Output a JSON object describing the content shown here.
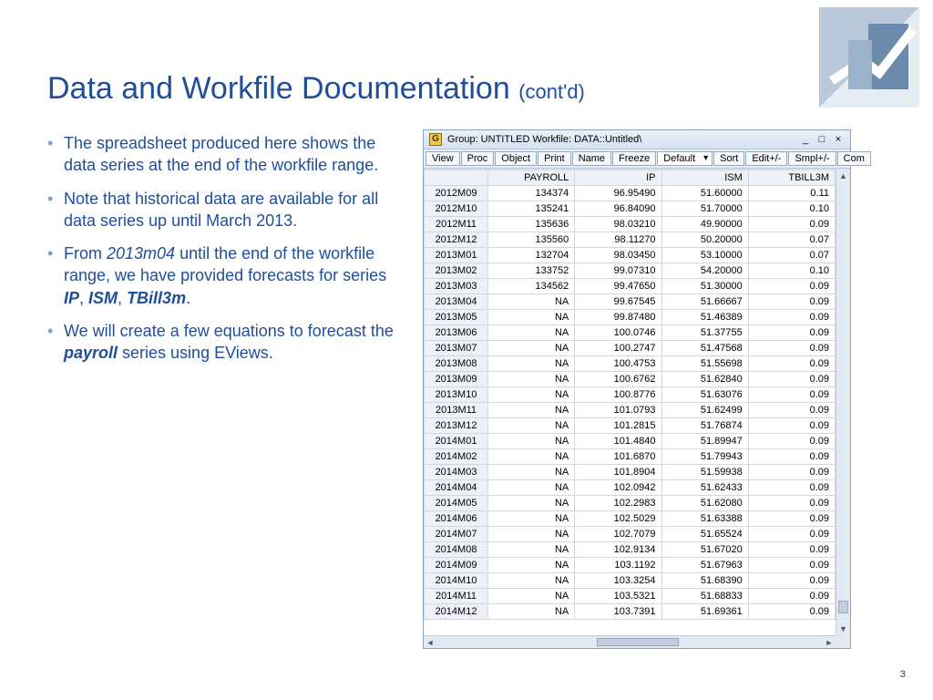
{
  "title_main": "Data and Workfile Documentation ",
  "title_contd": "(cont'd)",
  "bullets": [
    {
      "html": "The spreadsheet produced here shows the data series at the end of the workfile range."
    },
    {
      "html": " Note that historical data are available for all data series up until March 2013."
    },
    {
      "html": "From <em>2013m04</em> until the end of the workfile range, we have provided forecasts for series <strong>IP</strong>, <strong>ISM</strong>, <strong>TBill3m</strong>."
    },
    {
      "html": "We will create a few equations to forecast the <strong>payroll</strong> series using EViews."
    }
  ],
  "win": {
    "icon_letter": "G",
    "title": "Group: UNTITLED   Workfile: DATA::Untitled\\",
    "ctl_min": "_",
    "ctl_max": "□",
    "ctl_close": "×"
  },
  "toolbar": {
    "view": "View",
    "proc": "Proc",
    "object": "Object",
    "print": "Print",
    "name": "Name",
    "freeze": "Freeze",
    "default": "Default",
    "sort": "Sort",
    "editpm": "Edit+/-",
    "smplpm": "Smpl+/-",
    "com": "Com"
  },
  "columns": [
    "PAYROLL",
    "IP",
    "ISM",
    "TBILL3M"
  ],
  "rows": [
    {
      "obs": "2012M09",
      "c": [
        "134374",
        "96.95490",
        "51.60000",
        "0.11"
      ]
    },
    {
      "obs": "2012M10",
      "c": [
        "135241",
        "96.84090",
        "51.70000",
        "0.10"
      ]
    },
    {
      "obs": "2012M11",
      "c": [
        "135636",
        "98.03210",
        "49.90000",
        "0.09"
      ]
    },
    {
      "obs": "2012M12",
      "c": [
        "135560",
        "98.11270",
        "50.20000",
        "0.07"
      ]
    },
    {
      "obs": "2013M01",
      "c": [
        "132704",
        "98.03450",
        "53.10000",
        "0.07"
      ]
    },
    {
      "obs": "2013M02",
      "c": [
        "133752",
        "99.07310",
        "54.20000",
        "0.10"
      ]
    },
    {
      "obs": "2013M03",
      "c": [
        "134562",
        "99.47650",
        "51.30000",
        "0.09"
      ]
    },
    {
      "obs": "2013M04",
      "c": [
        "NA",
        "99.67545",
        "51.66667",
        "0.09"
      ]
    },
    {
      "obs": "2013M05",
      "c": [
        "NA",
        "99.87480",
        "51.46389",
        "0.09"
      ]
    },
    {
      "obs": "2013M06",
      "c": [
        "NA",
        "100.0746",
        "51.37755",
        "0.09"
      ]
    },
    {
      "obs": "2013M07",
      "c": [
        "NA",
        "100.2747",
        "51.47568",
        "0.09"
      ]
    },
    {
      "obs": "2013M08",
      "c": [
        "NA",
        "100.4753",
        "51.55698",
        "0.09"
      ]
    },
    {
      "obs": "2013M09",
      "c": [
        "NA",
        "100.6762",
        "51.62840",
        "0.09"
      ]
    },
    {
      "obs": "2013M10",
      "c": [
        "NA",
        "100.8776",
        "51.63076",
        "0.09"
      ]
    },
    {
      "obs": "2013M11",
      "c": [
        "NA",
        "101.0793",
        "51.62499",
        "0.09"
      ]
    },
    {
      "obs": "2013M12",
      "c": [
        "NA",
        "101.2815",
        "51.76874",
        "0.09"
      ]
    },
    {
      "obs": "2014M01",
      "c": [
        "NA",
        "101.4840",
        "51.89947",
        "0.09"
      ]
    },
    {
      "obs": "2014M02",
      "c": [
        "NA",
        "101.6870",
        "51.79943",
        "0.09"
      ]
    },
    {
      "obs": "2014M03",
      "c": [
        "NA",
        "101.8904",
        "51.59938",
        "0.09"
      ]
    },
    {
      "obs": "2014M04",
      "c": [
        "NA",
        "102.0942",
        "51.62433",
        "0.09"
      ]
    },
    {
      "obs": "2014M05",
      "c": [
        "NA",
        "102.2983",
        "51.62080",
        "0.09"
      ]
    },
    {
      "obs": "2014M06",
      "c": [
        "NA",
        "102.5029",
        "51.63388",
        "0.09"
      ]
    },
    {
      "obs": "2014M07",
      "c": [
        "NA",
        "102.7079",
        "51.65524",
        "0.09"
      ]
    },
    {
      "obs": "2014M08",
      "c": [
        "NA",
        "102.9134",
        "51.67020",
        "0.09"
      ]
    },
    {
      "obs": "2014M09",
      "c": [
        "NA",
        "103.1192",
        "51.67963",
        "0.09"
      ]
    },
    {
      "obs": "2014M10",
      "c": [
        "NA",
        "103.3254",
        "51.68390",
        "0.09"
      ]
    },
    {
      "obs": "2014M11",
      "c": [
        "NA",
        "103.5321",
        "51.68833",
        "0.09"
      ]
    },
    {
      "obs": "2014M12",
      "c": [
        "NA",
        "103.7391",
        "51.69361",
        "0.09"
      ]
    }
  ],
  "page_number": "3"
}
